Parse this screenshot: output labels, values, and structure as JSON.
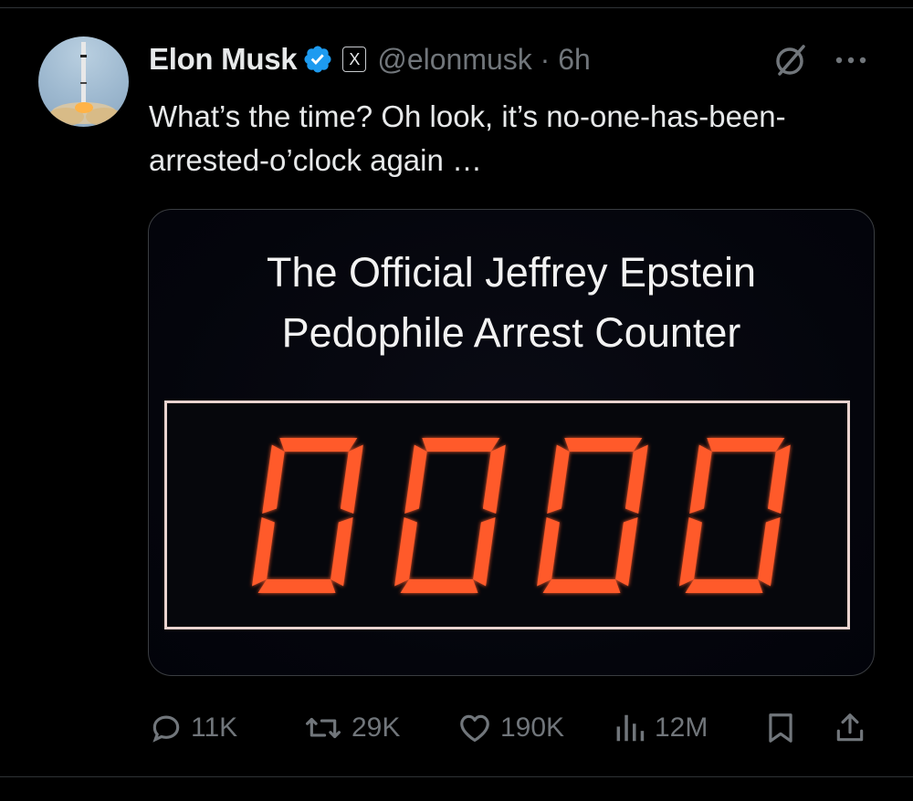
{
  "tweet": {
    "author_name": "Elon Musk",
    "handle_time": "@elonmusk · 6h",
    "x_badge": "X",
    "text": "What’s the time? Oh look, it’s no-one-has-been-arrested-o’clock again …",
    "icons": {
      "verified": "verified-badge-icon",
      "grok": "grok-icon",
      "more": "more-options-icon"
    }
  },
  "media": {
    "title": "The Official Jeffrey Epstein\nPedophile Arrest Counter",
    "counter_value": "0000",
    "colors": {
      "digit": "#ff5a2a",
      "frame": "#e9d3cf"
    }
  },
  "actions": {
    "reply_count": "11K",
    "repost_count": "29K",
    "like_count": "190K",
    "views_count": "12M",
    "icons": [
      "reply-icon",
      "repost-icon",
      "like-icon",
      "views-icon",
      "bookmark-icon",
      "share-icon"
    ]
  },
  "colors": {
    "background": "#000000",
    "text": "#e7e9ea",
    "muted": "#71767b",
    "verified": "#1d9bf0"
  }
}
